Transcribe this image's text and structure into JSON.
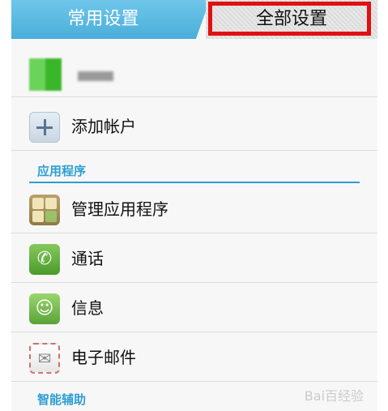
{
  "tabs": {
    "common_label": "常用设置",
    "all_label": "全部设置",
    "highlight_color": "#e01111",
    "accent": "#4aaed9"
  },
  "account_row": {
    "avatar_icon": "account-avatar-icon"
  },
  "add_account": {
    "label": "添加帐户",
    "icon": "plus-icon"
  },
  "sections": [
    {
      "title": "应用程序",
      "items": [
        {
          "label": "管理应用程序",
          "icon": "apps-grid-icon"
        },
        {
          "label": "通话",
          "icon": "phone-icon"
        },
        {
          "label": "信息",
          "icon": "message-icon"
        },
        {
          "label": "电子邮件",
          "icon": "mail-icon"
        }
      ]
    },
    {
      "title": "智能辅助",
      "items": []
    }
  ],
  "watermark": "Bai百经验"
}
